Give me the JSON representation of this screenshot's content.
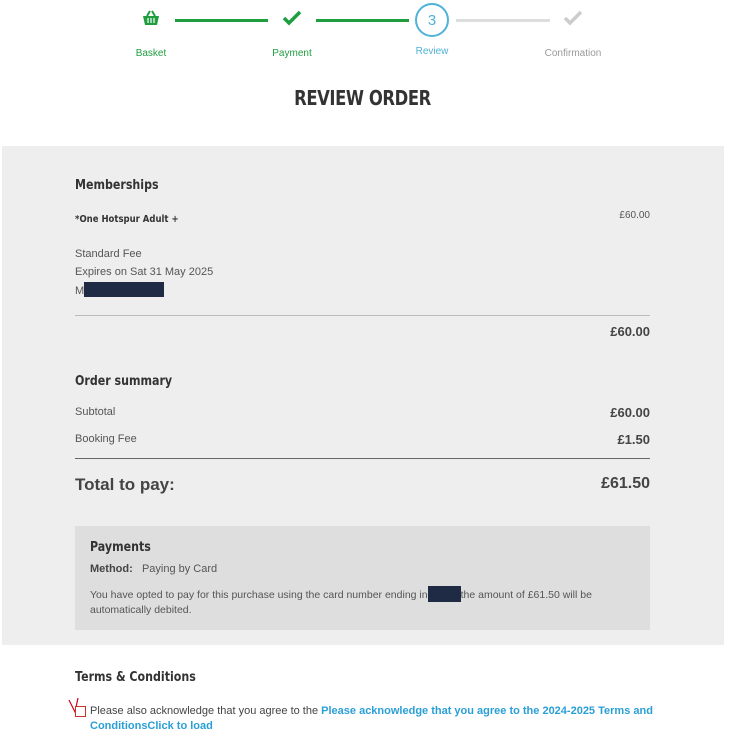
{
  "stepper": {
    "steps": [
      {
        "label": "Basket",
        "icon": "basket-icon",
        "state": "complete"
      },
      {
        "label": "Payment",
        "icon": "check-icon",
        "state": "complete"
      },
      {
        "label": "Review",
        "number": "3",
        "state": "current"
      },
      {
        "label": "Confirmation",
        "icon": "check-icon",
        "state": "upcoming"
      }
    ],
    "colors": {
      "complete": "#1e9e3e",
      "current": "#4fb3d9",
      "upcoming": "#cccccc"
    }
  },
  "page": {
    "title": "REVIEW ORDER"
  },
  "memberships": {
    "heading": "Memberships",
    "item_name": "*One Hotspur Adult +",
    "item_price": "£60.00",
    "fee_type": "Standard Fee",
    "expiry": "Expires on Sat 31 May 2025",
    "member_prefix": "M",
    "total": "£60.00"
  },
  "summary": {
    "heading": "Order summary",
    "subtotal_label": "Subtotal",
    "subtotal_value": "£60.00",
    "booking_label": "Booking Fee",
    "booking_value": "£1.50",
    "total_label": "Total to pay:",
    "total_value": "£61.50"
  },
  "payments": {
    "heading": "Payments",
    "method_label": "Method:",
    "method_value": "Paying by Card",
    "note_before": "You have opted to pay for this purchase using the card number ending in",
    "note_after": "the amount of £61.50 will be automatically debited."
  },
  "terms": {
    "heading": "Terms & Conditions",
    "text": "Please also acknowledge that you agree to the ",
    "link": "Please acknowledge that you agree to the 2024-2025 Terms and ConditionsClick to load"
  }
}
